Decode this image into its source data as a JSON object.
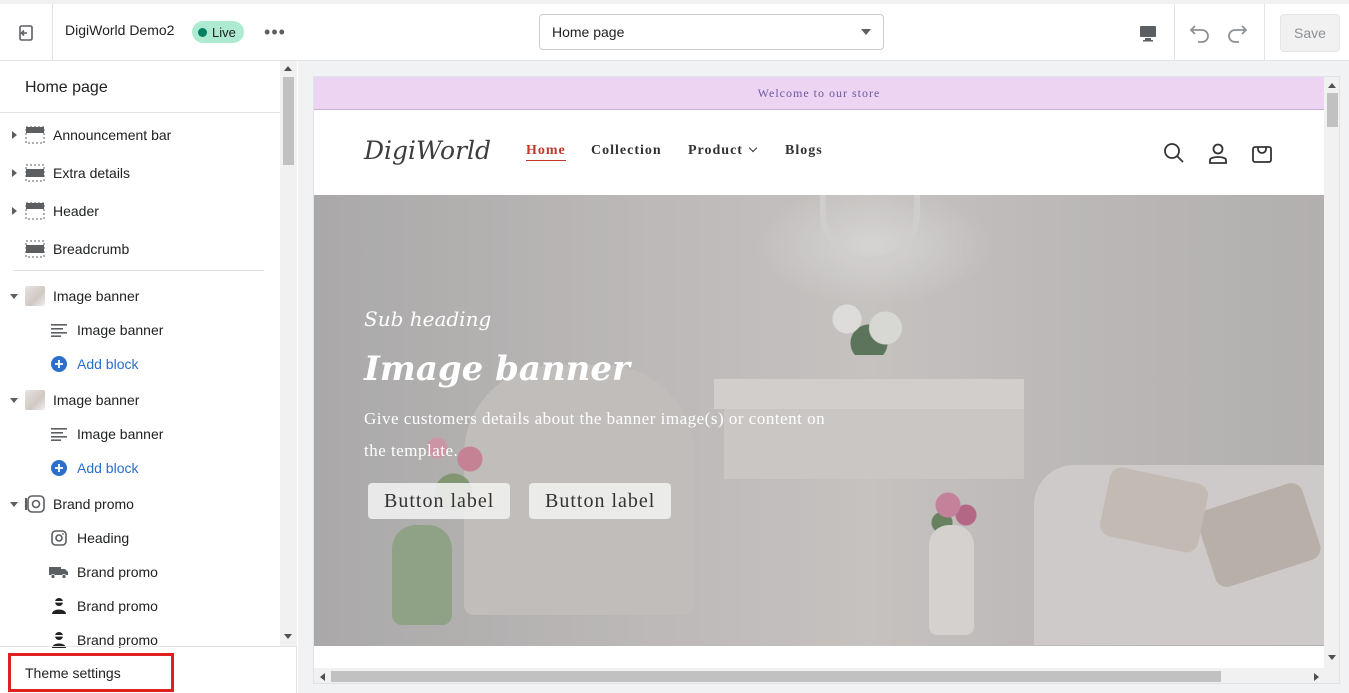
{
  "topbar": {
    "store_name": "DigiWorld Demo2",
    "live_label": "Live",
    "more_label": "•••",
    "page_select_value": "Home page",
    "save_label": "Save"
  },
  "sidebar": {
    "title": "Home page",
    "sections": [
      {
        "label": "Announcement bar",
        "icon": "section-icon"
      },
      {
        "label": "Extra details",
        "icon": "section-icon"
      },
      {
        "label": "Header",
        "icon": "section-icon"
      },
      {
        "label": "Breadcrumb",
        "icon": "section-icon"
      },
      {
        "label": "Image banner",
        "icon": "image-thumbnail"
      },
      {
        "label": "Image banner",
        "icon": "text-lines-icon"
      },
      {
        "label": "Add block",
        "icon": "plus-circle-icon"
      },
      {
        "label": "Image banner",
        "icon": "image-thumbnail"
      },
      {
        "label": "Image banner",
        "icon": "text-lines-icon"
      },
      {
        "label": "Add block",
        "icon": "plus-circle-icon"
      },
      {
        "label": "Brand promo",
        "icon": "instagram-icon"
      },
      {
        "label": "Heading",
        "icon": "instagram-icon"
      },
      {
        "label": "Brand promo",
        "icon": "truck-icon"
      },
      {
        "label": "Brand promo",
        "icon": "person-icon"
      },
      {
        "label": "Brand promo",
        "icon": "person-icon"
      }
    ],
    "footer_label": "Theme settings"
  },
  "preview": {
    "announcement": "Welcome to our store",
    "logo": "DigiWorld",
    "nav": [
      "Home",
      "Collection",
      "Product",
      "Blogs"
    ],
    "banner": {
      "sub_heading": "Sub heading",
      "title": "Image banner",
      "text": "Give customers details about the banner image(s) or content on the template.",
      "button1": "Button label",
      "button2": "Button label"
    }
  },
  "colors": {
    "accent_live": "#aee9d1",
    "highlight_box": "#e02020",
    "announce_bg": "#ecd4f2",
    "nav_active": "#c0392b",
    "link_blue": "#2c6ecb"
  }
}
